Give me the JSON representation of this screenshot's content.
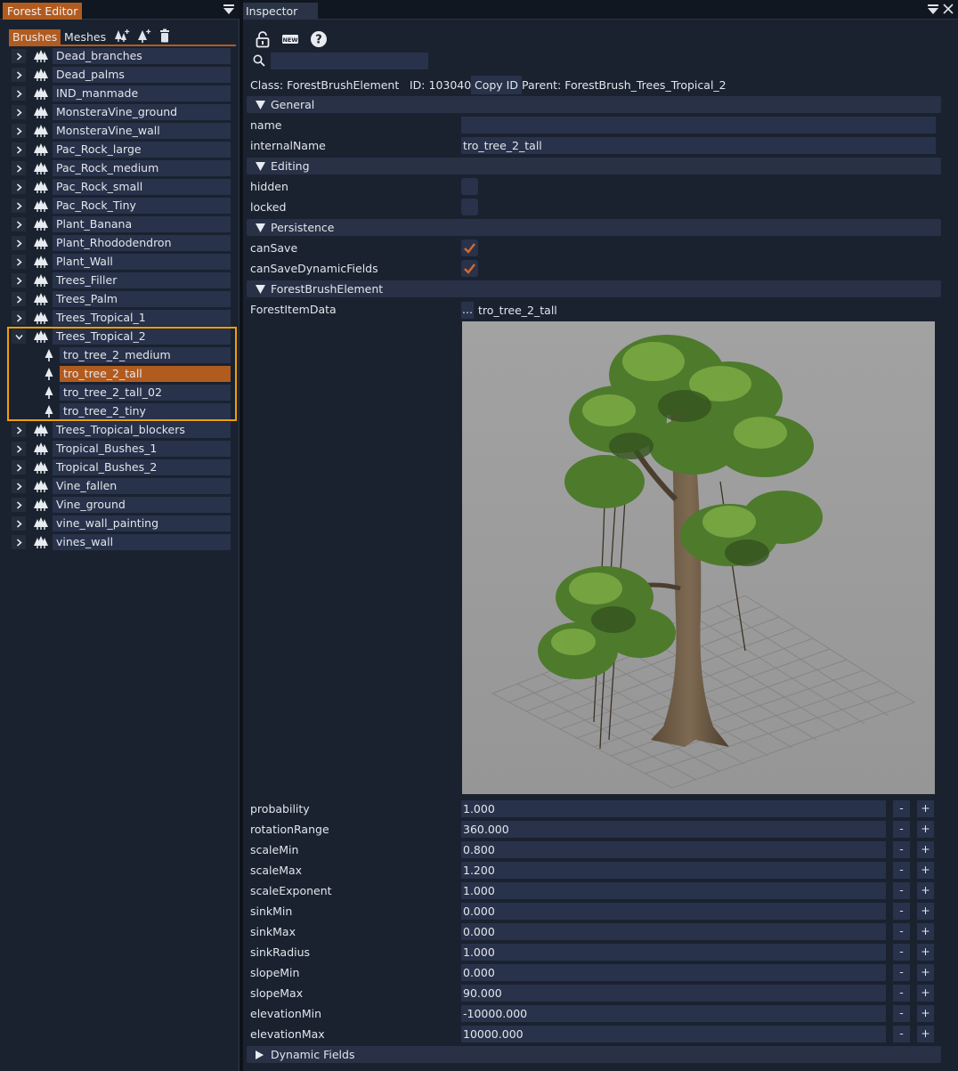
{
  "left_panel": {
    "title": "Forest Editor",
    "tabs": [
      {
        "label": "Brushes",
        "active": true
      },
      {
        "label": "Meshes",
        "active": false
      }
    ],
    "tool_icons": [
      "forest-add-icon",
      "tree-add-icon",
      "trash-icon"
    ],
    "tree": [
      {
        "label": "Dead_branches",
        "type": "brush",
        "expanded": false
      },
      {
        "label": "Dead_palms",
        "type": "brush",
        "expanded": false
      },
      {
        "label": "IND_manmade",
        "type": "brush",
        "expanded": false
      },
      {
        "label": "MonsteraVine_ground",
        "type": "brush",
        "expanded": false
      },
      {
        "label": "MonsteraVine_wall",
        "type": "brush",
        "expanded": false
      },
      {
        "label": "Pac_Rock_large",
        "type": "brush",
        "expanded": false
      },
      {
        "label": "Pac_Rock_medium",
        "type": "brush",
        "expanded": false
      },
      {
        "label": "Pac_Rock_small",
        "type": "brush",
        "expanded": false
      },
      {
        "label": "Pac_Rock_Tiny",
        "type": "brush",
        "expanded": false
      },
      {
        "label": "Plant_Banana",
        "type": "brush",
        "expanded": false
      },
      {
        "label": "Plant_Rhododendron",
        "type": "brush",
        "expanded": false
      },
      {
        "label": "Plant_Wall",
        "type": "brush",
        "expanded": false
      },
      {
        "label": "Trees_Filler",
        "type": "brush",
        "expanded": false
      },
      {
        "label": "Trees_Palm",
        "type": "brush",
        "expanded": false
      },
      {
        "label": "Trees_Tropical_1",
        "type": "brush",
        "expanded": false
      },
      {
        "label": "Trees_Tropical_2",
        "type": "brush",
        "expanded": true
      },
      {
        "label": "tro_tree_2_medium",
        "type": "element",
        "selected": false
      },
      {
        "label": "tro_tree_2_tall",
        "type": "element",
        "selected": true
      },
      {
        "label": "tro_tree_2_tall_02",
        "type": "element",
        "selected": false
      },
      {
        "label": "tro_tree_2_tiny",
        "type": "element",
        "selected": false
      },
      {
        "label": "Trees_Tropical_blockers",
        "type": "brush",
        "expanded": false
      },
      {
        "label": "Tropical_Bushes_1",
        "type": "brush",
        "expanded": false
      },
      {
        "label": "Tropical_Bushes_2",
        "type": "brush",
        "expanded": false
      },
      {
        "label": "Vine_fallen",
        "type": "brush",
        "expanded": false
      },
      {
        "label": "Vine_ground",
        "type": "brush",
        "expanded": false
      },
      {
        "label": "vine_wall_painting",
        "type": "brush",
        "expanded": false
      },
      {
        "label": "vines_wall",
        "type": "brush",
        "expanded": false
      }
    ]
  },
  "inspector": {
    "title": "Inspector",
    "toolbar_icons": [
      "lock-icon",
      "new-icon",
      "help-icon"
    ],
    "search": {
      "value": "",
      "placeholder": ""
    },
    "class_line": "Class:  ForestBrushElement",
    "id_line": "ID:  103040",
    "copy_id_label": "Copy ID",
    "parent_line": "Parent:  ForestBrush_Trees_Tropical_2",
    "sections": {
      "general": "General",
      "editing": "Editing",
      "persistence": "Persistence",
      "forest_brush_element": "ForestBrushElement",
      "dynamic_fields": "Dynamic Fields"
    },
    "general": {
      "name_label": "name",
      "name_value": "",
      "internal_name_label": "internalName",
      "internal_name_value": "tro_tree_2_tall"
    },
    "editing": {
      "hidden_label": "hidden",
      "hidden_checked": false,
      "locked_label": "locked",
      "locked_checked": false
    },
    "persistence": {
      "can_save_label": "canSave",
      "can_save_checked": true,
      "can_save_dynamic_label": "canSaveDynamicFields",
      "can_save_dynamic_checked": true
    },
    "forest_item_data": {
      "label": "ForestItemData",
      "browse_label": "...",
      "value": "tro_tree_2_tall"
    },
    "numeric_props": [
      {
        "label": "probability",
        "value": "1.000"
      },
      {
        "label": "rotationRange",
        "value": "360.000"
      },
      {
        "label": "scaleMin",
        "value": "0.800"
      },
      {
        "label": "scaleMax",
        "value": "1.200"
      },
      {
        "label": "scaleExponent",
        "value": "1.000"
      },
      {
        "label": "sinkMin",
        "value": "0.000"
      },
      {
        "label": "sinkMax",
        "value": "0.000"
      },
      {
        "label": "sinkRadius",
        "value": "1.000"
      },
      {
        "label": "slopeMin",
        "value": "0.000"
      },
      {
        "label": "slopeMax",
        "value": "90.000"
      },
      {
        "label": "elevationMin",
        "value": "-10000.000"
      },
      {
        "label": "elevationMax",
        "value": "10000.000"
      }
    ],
    "minus_label": "-",
    "plus_label": "+"
  },
  "colors": {
    "accent": "#b25b1f",
    "highlight_box": "#f0a000",
    "panel_bg": "#1a2230",
    "field_bg": "#28324a"
  }
}
